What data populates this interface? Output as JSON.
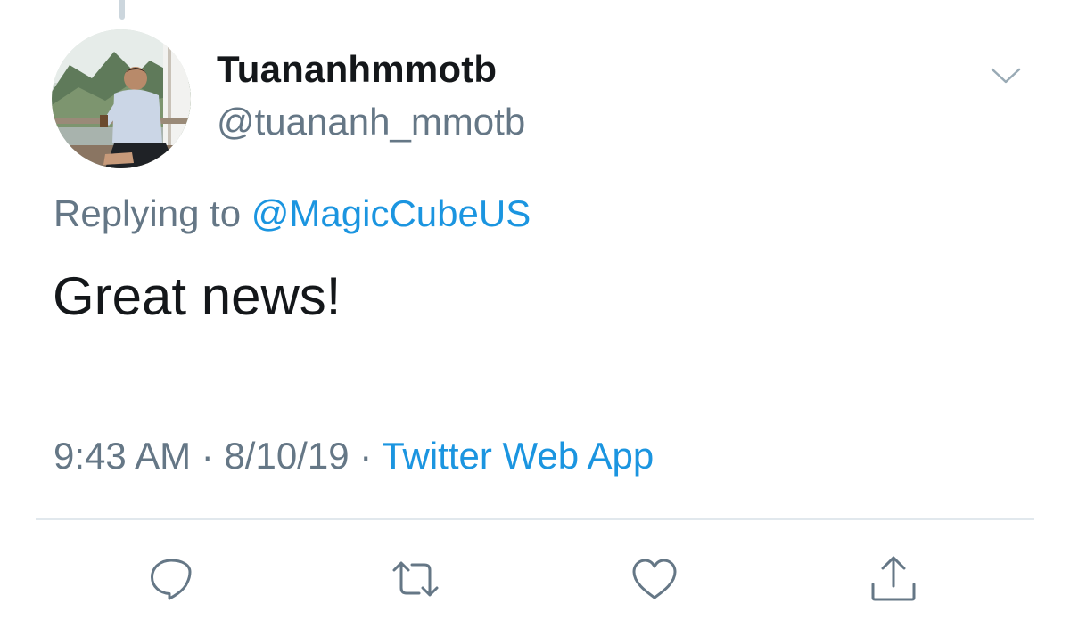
{
  "tweet": {
    "author": {
      "display_name": "Tuananhmmotb",
      "handle": "@tuananh_mmotb"
    },
    "replying": {
      "prefix": "Replying to ",
      "mention": "@MagicCubeUS"
    },
    "text": "Great news!",
    "meta": {
      "time": "9:43 AM",
      "separator1": " · ",
      "date": "8/10/19",
      "separator2": " · ",
      "source": "Twitter Web App"
    }
  },
  "actions": [
    {
      "name": "reply",
      "icon": "reply-icon"
    },
    {
      "name": "retweet",
      "icon": "retweet-icon"
    },
    {
      "name": "like",
      "icon": "heart-icon"
    },
    {
      "name": "share",
      "icon": "share-icon"
    }
  ],
  "colors": {
    "accent": "#1b95e0",
    "secondary_text": "#657786",
    "primary_text": "#14171a",
    "icon": "#657786",
    "divider": "#e1e8ed"
  }
}
